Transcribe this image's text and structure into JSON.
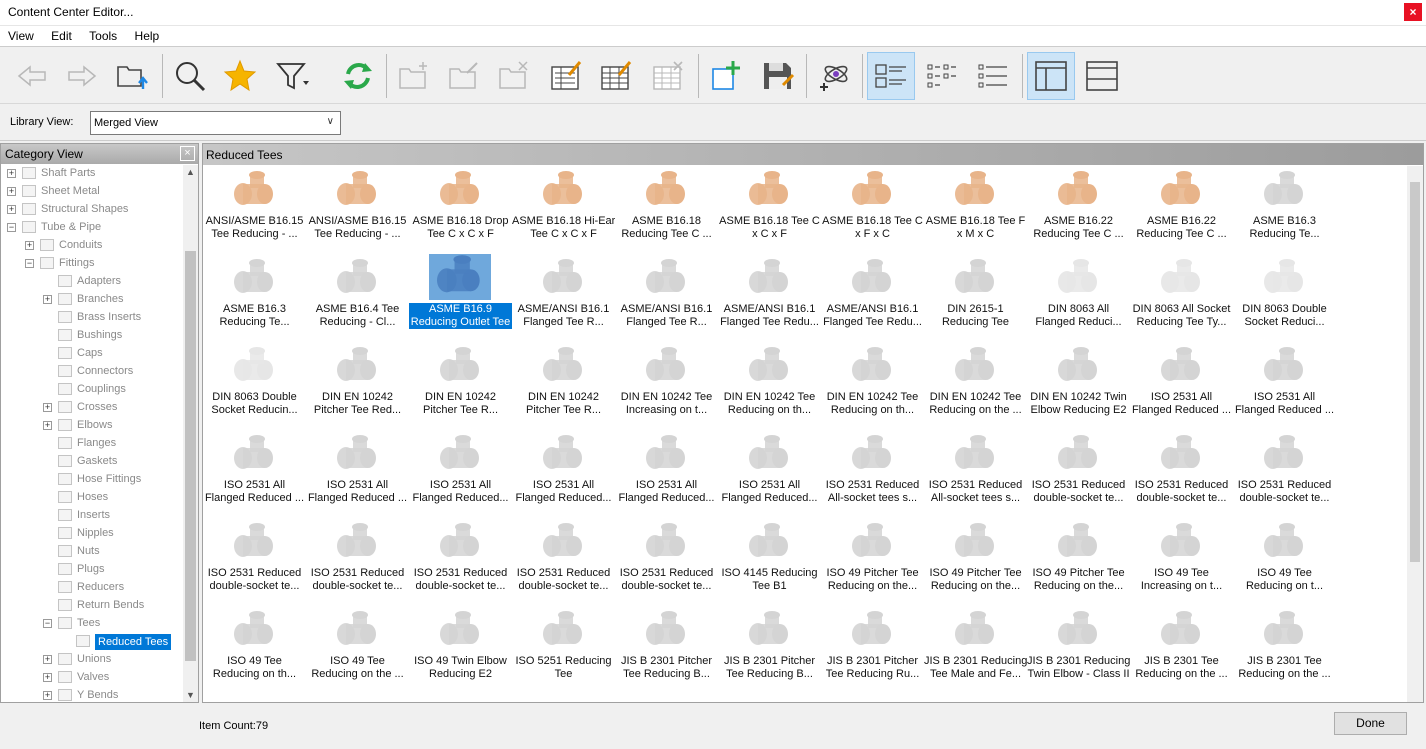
{
  "window": {
    "title": "Content Center Editor...",
    "close": "×"
  },
  "menu": [
    "View",
    "Edit",
    "Tools",
    "Help"
  ],
  "toolbar": {
    "icons": [
      "back-arrow-icon",
      "forward-arrow-icon",
      "folder-up-icon",
      "search-icon",
      "favorite-star-icon",
      "filter-icon",
      "refresh-icon",
      "new-family-icon",
      "edit-family-icon",
      "delete-family-icon",
      "family-properties-icon",
      "table-edit-icon",
      "table-delete-icon",
      "new-library-icon",
      "save-icon",
      "publish-icon",
      "large-icons-view-icon",
      "list-view-icon",
      "details-view-icon",
      "tree-view-icon",
      "table-view-icon"
    ],
    "active": [
      "large-icons-view-icon",
      "tree-view-icon"
    ]
  },
  "library": {
    "label": "Library View:",
    "value": "Merged View"
  },
  "category_view": {
    "title": "Category View",
    "close": "×",
    "items": [
      {
        "label": "Shaft Parts",
        "level": 0,
        "toggle": "+"
      },
      {
        "label": "Sheet Metal",
        "level": 0,
        "toggle": "+"
      },
      {
        "label": "Structural Shapes",
        "level": 0,
        "toggle": "+"
      },
      {
        "label": "Tube & Pipe",
        "level": 0,
        "toggle": "−"
      },
      {
        "label": "Conduits",
        "level": 1,
        "toggle": "+"
      },
      {
        "label": "Fittings",
        "level": 1,
        "toggle": "−"
      },
      {
        "label": "Adapters",
        "level": 2,
        "toggle": ""
      },
      {
        "label": "Branches",
        "level": 2,
        "toggle": "+"
      },
      {
        "label": "Brass Inserts",
        "level": 2,
        "toggle": ""
      },
      {
        "label": "Bushings",
        "level": 2,
        "toggle": ""
      },
      {
        "label": "Caps",
        "level": 2,
        "toggle": ""
      },
      {
        "label": "Connectors",
        "level": 2,
        "toggle": ""
      },
      {
        "label": "Couplings",
        "level": 2,
        "toggle": ""
      },
      {
        "label": "Crosses",
        "level": 2,
        "toggle": "+"
      },
      {
        "label": "Elbows",
        "level": 2,
        "toggle": "+"
      },
      {
        "label": "Flanges",
        "level": 2,
        "toggle": ""
      },
      {
        "label": "Gaskets",
        "level": 2,
        "toggle": ""
      },
      {
        "label": "Hose Fittings",
        "level": 2,
        "toggle": ""
      },
      {
        "label": "Hoses",
        "level": 2,
        "toggle": ""
      },
      {
        "label": "Inserts",
        "level": 2,
        "toggle": ""
      },
      {
        "label": "Nipples",
        "level": 2,
        "toggle": ""
      },
      {
        "label": "Nuts",
        "level": 2,
        "toggle": ""
      },
      {
        "label": "Plugs",
        "level": 2,
        "toggle": ""
      },
      {
        "label": "Reducers",
        "level": 2,
        "toggle": ""
      },
      {
        "label": "Return Bends",
        "level": 2,
        "toggle": ""
      },
      {
        "label": "Tees",
        "level": 2,
        "toggle": "−"
      },
      {
        "label": "Reduced Tees",
        "level": 3,
        "toggle": "",
        "selected": true
      },
      {
        "label": "Unions",
        "level": 2,
        "toggle": "+"
      },
      {
        "label": "Valves",
        "level": 2,
        "toggle": "+"
      },
      {
        "label": "Y Bends",
        "level": 2,
        "toggle": "+"
      }
    ]
  },
  "content": {
    "title": "Reduced Tees",
    "items": [
      {
        "caption": "ANSI/ASME B16.15\nTee Reducing - ...",
        "color": "#e8b48a"
      },
      {
        "caption": "ANSI/ASME B16.15\nTee Reducing - ...",
        "color": "#e8b48a"
      },
      {
        "caption": "ASME B16.18 Drop\nTee C x C x F",
        "color": "#e8b48a"
      },
      {
        "caption": "ASME B16.18 Hi-Ear\nTee C x C x F",
        "color": "#e8b48a"
      },
      {
        "caption": "ASME B16.18\nReducing Tee C ...",
        "color": "#e8b48a"
      },
      {
        "caption": "ASME B16.18 Tee C\nx C x F",
        "color": "#e8b48a"
      },
      {
        "caption": "ASME B16.18 Tee C\nx F x C",
        "color": "#e8b48a"
      },
      {
        "caption": "ASME B16.18 Tee F\nx M x C",
        "color": "#e8b48a"
      },
      {
        "caption": "ASME B16.22\nReducing Tee C ...",
        "color": "#e8b48a"
      },
      {
        "caption": "ASME B16.22\nReducing Tee C ...",
        "color": "#e8b48a"
      },
      {
        "caption": "ASME B16.3\nReducing Te...",
        "color": "#d4d4d4"
      },
      {
        "caption": "ASME B16.3\nReducing Te...",
        "color": "#d4d4d4"
      },
      {
        "caption": "ASME B16.4 Tee\nReducing - Cl...",
        "color": "#d4d4d4"
      },
      {
        "caption": "ASME B16.9\nReducing Outlet Tee",
        "color": "#4a7fc0",
        "selected": true
      },
      {
        "caption": "ASME/ANSI B16.1\nFlanged Tee R...",
        "color": "#d4d4d4"
      },
      {
        "caption": "ASME/ANSI B16.1\nFlanged Tee R...",
        "color": "#d4d4d4"
      },
      {
        "caption": "ASME/ANSI B16.1\nFlanged Tee Redu...",
        "color": "#d4d4d4"
      },
      {
        "caption": "ASME/ANSI B16.1\nFlanged Tee Redu...",
        "color": "#d4d4d4"
      },
      {
        "caption": "DIN 2615-1\nReducing Tee",
        "color": "#d4d4d4"
      },
      {
        "caption": "DIN 8063 All\nFlanged Reduci...",
        "color": "#e6e6e6"
      },
      {
        "caption": "DIN 8063 All Socket\nReducing Tee Ty...",
        "color": "#e6e6e6"
      },
      {
        "caption": "DIN 8063 Double\nSocket Reduci...",
        "color": "#e6e6e6"
      },
      {
        "caption": "DIN 8063 Double\nSocket Reducin...",
        "color": "#e6e6e6"
      },
      {
        "caption": "DIN EN 10242\nPitcher Tee Red...",
        "color": "#d4d4d4"
      },
      {
        "caption": "DIN EN 10242\nPitcher Tee R...",
        "color": "#d4d4d4"
      },
      {
        "caption": "DIN EN 10242\nPitcher Tee R...",
        "color": "#d4d4d4"
      },
      {
        "caption": "DIN EN 10242 Tee\nIncreasing on t...",
        "color": "#d4d4d4"
      },
      {
        "caption": "DIN EN 10242 Tee\nReducing on th...",
        "color": "#d4d4d4"
      },
      {
        "caption": "DIN EN 10242 Tee\nReducing on th...",
        "color": "#d4d4d4"
      },
      {
        "caption": "DIN EN 10242 Tee\nReducing on the ...",
        "color": "#d4d4d4"
      },
      {
        "caption": "DIN EN 10242 Twin\nElbow Reducing E2",
        "color": "#d4d4d4"
      },
      {
        "caption": "ISO 2531 All\nFlanged Reduced ...",
        "color": "#d4d4d4"
      },
      {
        "caption": "ISO 2531 All\nFlanged Reduced ...",
        "color": "#d4d4d4"
      },
      {
        "caption": "ISO 2531 All\nFlanged Reduced ...",
        "color": "#d4d4d4"
      },
      {
        "caption": "ISO 2531 All\nFlanged Reduced ...",
        "color": "#d4d4d4"
      },
      {
        "caption": "ISO 2531 All\nFlanged Reduced...",
        "color": "#d4d4d4"
      },
      {
        "caption": "ISO 2531 All\nFlanged Reduced...",
        "color": "#d4d4d4"
      },
      {
        "caption": "ISO 2531 All\nFlanged Reduced...",
        "color": "#d4d4d4"
      },
      {
        "caption": "ISO 2531 All\nFlanged Reduced...",
        "color": "#d4d4d4"
      },
      {
        "caption": "ISO 2531 Reduced\nAll-socket tees s...",
        "color": "#d4d4d4"
      },
      {
        "caption": "ISO 2531 Reduced\nAll-socket tees s...",
        "color": "#d4d4d4"
      },
      {
        "caption": "ISO 2531 Reduced\ndouble-socket te...",
        "color": "#d4d4d4"
      },
      {
        "caption": "ISO 2531 Reduced\ndouble-socket te...",
        "color": "#d4d4d4"
      },
      {
        "caption": "ISO 2531 Reduced\ndouble-socket te...",
        "color": "#d4d4d4"
      },
      {
        "caption": "ISO 2531 Reduced\ndouble-socket te...",
        "color": "#d4d4d4"
      },
      {
        "caption": "ISO 2531 Reduced\ndouble-socket te...",
        "color": "#d4d4d4"
      },
      {
        "caption": "ISO 2531 Reduced\ndouble-socket te...",
        "color": "#d4d4d4"
      },
      {
        "caption": "ISO 2531 Reduced\ndouble-socket te...",
        "color": "#d4d4d4"
      },
      {
        "caption": "ISO 2531 Reduced\ndouble-socket te...",
        "color": "#d4d4d4"
      },
      {
        "caption": "ISO 4145 Reducing\nTee B1",
        "color": "#d4d4d4"
      },
      {
        "caption": "ISO 49 Pitcher Tee\nReducing on the...",
        "color": "#d4d4d4"
      },
      {
        "caption": "ISO 49 Pitcher Tee\nReducing on the...",
        "color": "#d4d4d4"
      },
      {
        "caption": "ISO 49 Pitcher Tee\nReducing on the...",
        "color": "#d4d4d4"
      },
      {
        "caption": "ISO 49 Tee\nIncreasing on t...",
        "color": "#d4d4d4"
      },
      {
        "caption": "ISO 49 Tee\nReducing on t...",
        "color": "#d4d4d4"
      },
      {
        "caption": "ISO 49 Tee\nReducing on th...",
        "color": "#d4d4d4"
      },
      {
        "caption": "ISO 49 Tee\nReducing on the ...",
        "color": "#d4d4d4"
      },
      {
        "caption": "ISO 49 Twin Elbow\nReducing E2",
        "color": "#d4d4d4"
      },
      {
        "caption": "ISO 5251 Reducing\nTee",
        "color": "#d4d4d4"
      },
      {
        "caption": "JIS B 2301 Pitcher\nTee Reducing B...",
        "color": "#d4d4d4"
      },
      {
        "caption": "JIS B 2301 Pitcher\nTee Reducing B...",
        "color": "#d4d4d4"
      },
      {
        "caption": "JIS B 2301 Pitcher\nTee Reducing Ru...",
        "color": "#d4d4d4"
      },
      {
        "caption": "JIS B 2301 Reducing\nTee Male and Fe...",
        "color": "#d4d4d4"
      },
      {
        "caption": "JIS B 2301 Reducing\nTwin Elbow - Class II",
        "color": "#d4d4d4"
      },
      {
        "caption": "JIS B 2301 Tee\nReducing on the ...",
        "color": "#d4d4d4"
      },
      {
        "caption": "JIS B 2301 Tee\nReducing on the ...",
        "color": "#d4d4d4"
      }
    ]
  },
  "status": {
    "item_count": "Item Count:79",
    "done_label": "Done"
  }
}
